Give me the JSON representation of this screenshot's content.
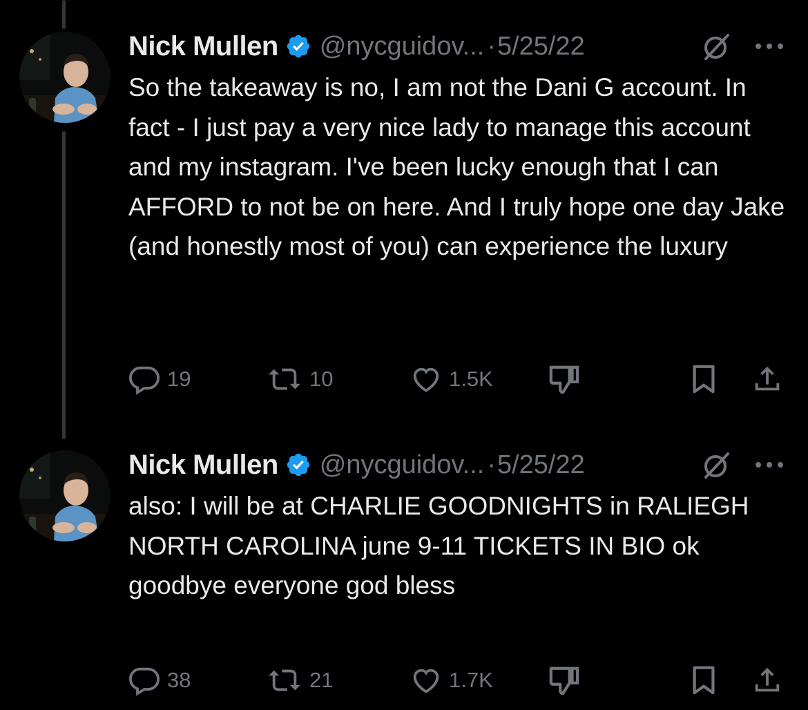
{
  "colors": {
    "background": "#000000",
    "primary_text": "#e7e9ea",
    "secondary_text": "#71767b",
    "verified_badge": "#1d9bf0",
    "thread_line": "#333639"
  },
  "tweets": [
    {
      "author_name": "Nick Mullen",
      "handle": "@nycguidov...",
      "separator": "·",
      "date": "5/25/22",
      "text": "So the takeaway is no, I am not the Dani G account. In fact - I just pay a very nice lady to manage this account and my instagram. I've been lucky enough that I can AFFORD to not be on here. And I truly hope one day Jake (and honestly most of you) can experience the luxury",
      "replies": "19",
      "reposts": "10",
      "likes": "1.5K"
    },
    {
      "author_name": "Nick Mullen",
      "handle": "@nycguidov...",
      "separator": "·",
      "date": "5/25/22",
      "text": "also: I will be at CHARLIE GOODNIGHTS in RALIEGH NORTH CAROLINA june 9-11 TICKETS IN BIO ok goodbye everyone god bless",
      "replies": "38",
      "reposts": "21",
      "likes": "1.7K"
    }
  ],
  "icons": {
    "reply": "speech-bubble-icon",
    "repost": "repost-arrows-icon",
    "like": "heart-icon",
    "dislike": "thumbs-down-icon",
    "bookmark": "bookmark-icon",
    "share": "share-upload-icon",
    "grok": "grok-slash-icon",
    "more": "more-dots-icon",
    "verified": "verified-badge-icon"
  }
}
